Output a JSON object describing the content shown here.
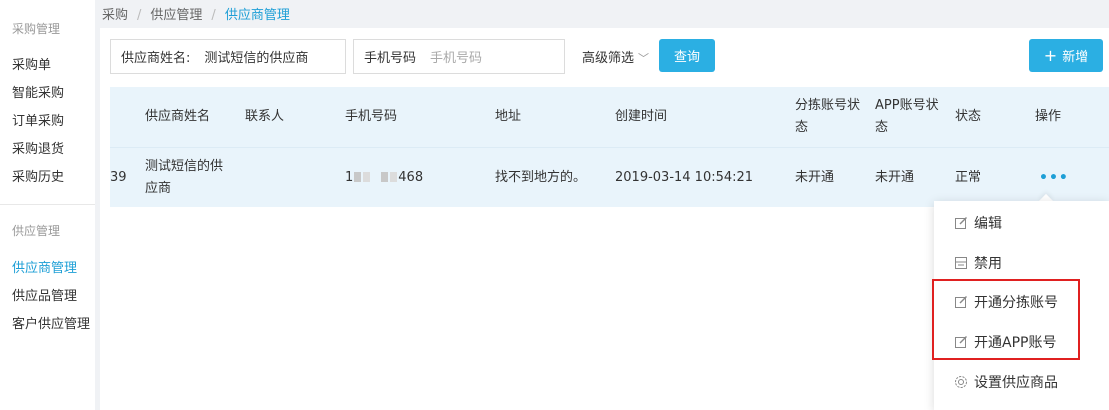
{
  "sidebar": {
    "group1_title": "采购管理",
    "group1_items": [
      "采购单",
      "智能采购",
      "订单采购",
      "采购退货",
      "采购历史"
    ],
    "group2_title": "供应管理",
    "group2_items": [
      "供应商管理",
      "供应品管理",
      "客户供应管理"
    ],
    "active_item": "供应商管理"
  },
  "breadcrumb": [
    "采购",
    "供应管理",
    "供应商管理"
  ],
  "filters": {
    "supplier_name_label": "供应商姓名:",
    "supplier_name_value": "测试短信的供应商",
    "phone_label": "手机号码",
    "phone_placeholder": "手机号码",
    "advanced_label": "高级筛选",
    "query_button": "查询",
    "new_button": "新增"
  },
  "table": {
    "columns": [
      "供应商姓名",
      "联系人",
      "手机号码",
      "地址",
      "创建时间",
      "分拣账号状态",
      "APP账号状态",
      "状态",
      "操作"
    ],
    "rows": [
      {
        "id_partial": "39",
        "supplier_name": "测试短信的供应商",
        "contact": "",
        "phone_prefix": "1",
        "phone_suffix": "468",
        "address": "找不到地方的。",
        "created": "2019-03-14 10:54:21",
        "sort_status": "未开通",
        "app_status": "未开通",
        "status": "正常",
        "action": "•••"
      }
    ]
  },
  "dropdown": {
    "items": [
      "编辑",
      "禁用",
      "开通分拣账号",
      "开通APP账号",
      "设置供应商品"
    ],
    "highlight_color": "#e02020"
  },
  "colors": {
    "accent": "#1e9fd6",
    "button": "#2bafe3",
    "row_bg": "#e9f4fb"
  }
}
